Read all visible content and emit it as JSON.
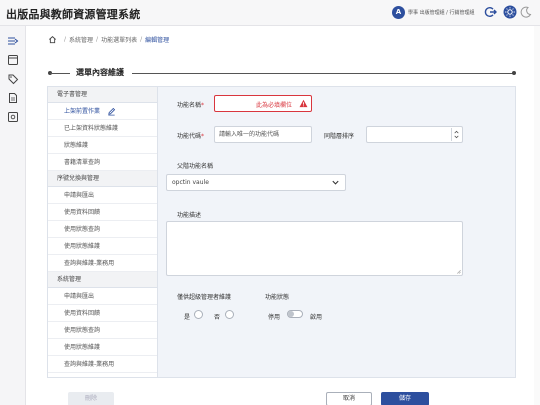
{
  "header": {
    "app_title": "出版品與教師資源管理系統",
    "avatar_letter": "A",
    "user_name": "學事 出版管理組 / 行銷管理組"
  },
  "breadcrumb": {
    "items": [
      "系統管理",
      "功能選單列表",
      "編輯管理"
    ]
  },
  "section": {
    "title": "選單內容維護"
  },
  "submenu": {
    "groups": [
      {
        "label": "電子書管理",
        "items": [
          "上架前置作業",
          "已上架資料狀態維護",
          "狀態維護",
          "書籍清單查詢"
        ]
      },
      {
        "label": "序號兌換與管理",
        "items": [
          "申請與匯出",
          "使用資料回饋",
          "使用狀態查詢",
          "使用狀態維護",
          "查詢與維護-業務用"
        ]
      },
      {
        "label": "系統管理",
        "items": [
          "申請與匯出",
          "使用資料回饋",
          "使用狀態查詢",
          "使用狀態維護",
          "查詢與維護-業務用"
        ]
      }
    ]
  },
  "form": {
    "name_label": "功能名稱",
    "required_mark": "*",
    "name_error": "此為必填欄位",
    "code_label": "功能代碼",
    "code_placeholder": "請輸入唯一的功能代碼",
    "order_label": "同階層排序",
    "parent_label": "父階功能名稱",
    "parent_value": "opctin vaule",
    "desc_label": "功能描述",
    "admin_only_label": "僅供超級管理者維護",
    "yes_label": "是",
    "no_label": "否",
    "status_label": "功能狀態",
    "disable_label": "停用",
    "enable_label": "啟用",
    "enabled": false
  },
  "footer": {
    "delete_label": "刪除",
    "cancel_label": "取消",
    "save_label": "儲存"
  },
  "colors": {
    "accent": "#2d4f9e",
    "error": "#d9363e",
    "panel_bg": "#f1f4f9"
  }
}
